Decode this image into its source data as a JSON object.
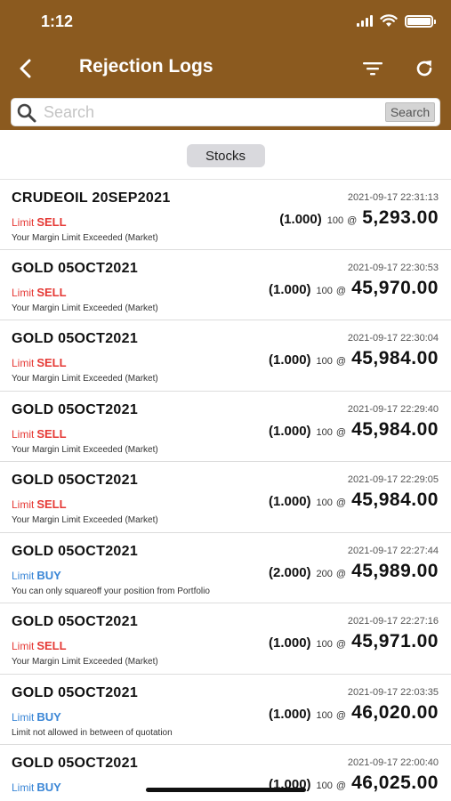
{
  "status_bar": {
    "time": "1:12"
  },
  "nav": {
    "title": "Rejection Logs"
  },
  "search": {
    "placeholder": "Search",
    "button_label": "Search"
  },
  "section": {
    "label": "Stocks"
  },
  "colors": {
    "header": "#8b5a1f",
    "sell": "#e53935",
    "buy": "#3a86d6"
  },
  "logs": [
    {
      "symbol": "CRUDEOIL 20SEP2021",
      "timestamp": "2021-09-17 22:31:13",
      "type": "Limit",
      "side": "SELL",
      "lots": "(1.000)",
      "qty": "100",
      "at": "@",
      "price": "5,293.00",
      "message": "Your Margin Limit Exceeded (Market)"
    },
    {
      "symbol": "GOLD 05OCT2021",
      "timestamp": "2021-09-17 22:30:53",
      "type": "Limit",
      "side": "SELL",
      "lots": "(1.000)",
      "qty": "100",
      "at": "@",
      "price": "45,970.00",
      "message": "Your Margin Limit Exceeded (Market)"
    },
    {
      "symbol": "GOLD 05OCT2021",
      "timestamp": "2021-09-17 22:30:04",
      "type": "Limit",
      "side": "SELL",
      "lots": "(1.000)",
      "qty": "100",
      "at": "@",
      "price": "45,984.00",
      "message": "Your Margin Limit Exceeded (Market)"
    },
    {
      "symbol": "GOLD 05OCT2021",
      "timestamp": "2021-09-17 22:29:40",
      "type": "Limit",
      "side": "SELL",
      "lots": "(1.000)",
      "qty": "100",
      "at": "@",
      "price": "45,984.00",
      "message": "Your Margin Limit Exceeded (Market)"
    },
    {
      "symbol": "GOLD 05OCT2021",
      "timestamp": "2021-09-17 22:29:05",
      "type": "Limit",
      "side": "SELL",
      "lots": "(1.000)",
      "qty": "100",
      "at": "@",
      "price": "45,984.00",
      "message": "Your Margin Limit Exceeded (Market)"
    },
    {
      "symbol": "GOLD 05OCT2021",
      "timestamp": "2021-09-17 22:27:44",
      "type": "Limit",
      "side": "BUY",
      "lots": "(2.000)",
      "qty": "200",
      "at": "@",
      "price": "45,989.00",
      "message": "You can only squareoff your position from Portfolio"
    },
    {
      "symbol": "GOLD 05OCT2021",
      "timestamp": "2021-09-17 22:27:16",
      "type": "Limit",
      "side": "SELL",
      "lots": "(1.000)",
      "qty": "100",
      "at": "@",
      "price": "45,971.00",
      "message": "Your Margin Limit Exceeded (Market)"
    },
    {
      "symbol": "GOLD 05OCT2021",
      "timestamp": "2021-09-17 22:03:35",
      "type": "Limit",
      "side": "BUY",
      "lots": "(1.000)",
      "qty": "100",
      "at": "@",
      "price": "46,020.00",
      "message": "Limit not allowed in between of quotation"
    },
    {
      "symbol": "GOLD 05OCT2021",
      "timestamp": "2021-09-17 22:00:40",
      "type": "Limit",
      "side": "BUY",
      "lots": "(1.000)",
      "qty": "100",
      "at": "@",
      "price": "46,025.00",
      "message": ""
    }
  ]
}
